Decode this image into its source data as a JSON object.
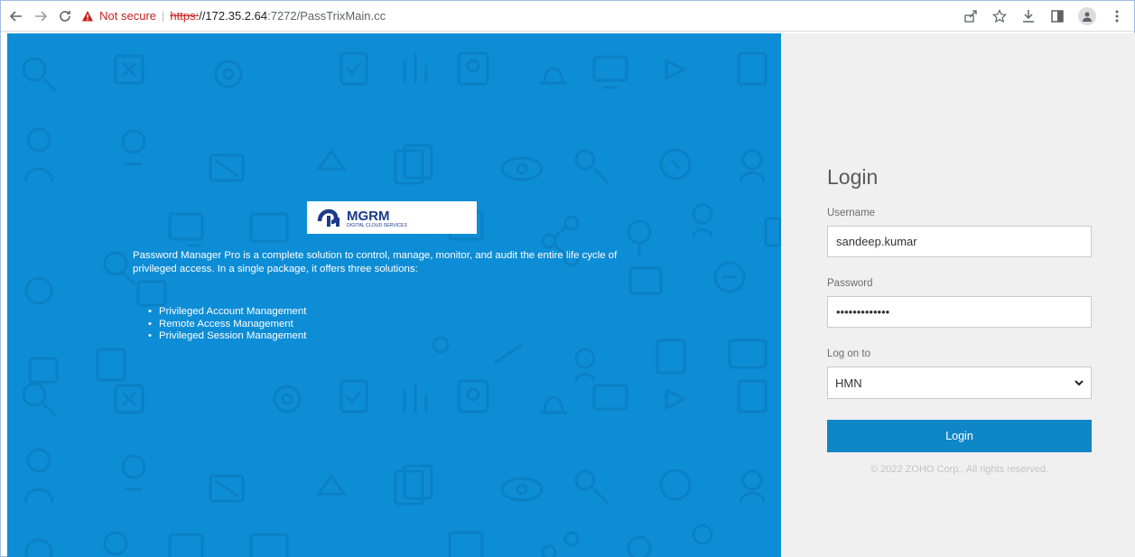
{
  "browser": {
    "security_label": "Not secure",
    "url_scheme": "https:",
    "url_host": "//172.35.2.64",
    "url_path": ":7272/PassTrixMain.cc",
    "icons": [
      "back-arrow-icon",
      "forward-arrow-icon",
      "reload-icon",
      "warning-icon",
      "share-icon",
      "star-icon",
      "download-icon",
      "side-panel-icon",
      "profile-icon",
      "kebab-menu-icon"
    ]
  },
  "hero": {
    "logo": {
      "brand": "MGRM",
      "tagline": "DIGITAL CLOUD SERVICES"
    },
    "intro_text": "Password Manager Pro is a complete solution to control, manage, monitor, and audit the entire life cycle of privileged access. In a single package, it offers three solutions:",
    "features": [
      "Privileged Account Management",
      "Remote Access Management",
      "Privileged Session Management"
    ],
    "background_color": "#0d8dd6"
  },
  "login": {
    "title": "Login",
    "username_label": "Username",
    "username_value": "sandeep.kumar",
    "password_label": "Password",
    "password_value": "•••••••••••••",
    "logon_label": "Log on to",
    "logon_value": "HMN",
    "button_label": "Login",
    "copyright": "© 2022 ZOHO Corp., All rights reserved.",
    "accent_color": "#0f86c6"
  }
}
